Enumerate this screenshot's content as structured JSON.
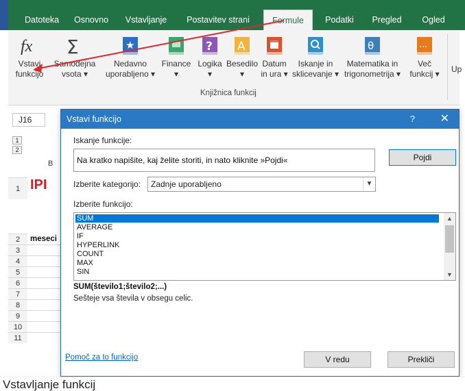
{
  "ribbon_tabs": [
    {
      "label": "Datoteka"
    },
    {
      "label": "Osnovno"
    },
    {
      "label": "Vstavljanje"
    },
    {
      "label": "Postavitev strani"
    },
    {
      "label": "Formule",
      "active": true
    },
    {
      "label": "Podatki"
    },
    {
      "label": "Pregled"
    },
    {
      "label": "Ogled"
    }
  ],
  "ribbon": {
    "buttons": [
      {
        "line1": "Vstavi",
        "line2": "funkcijo",
        "icon": "fx-icon"
      },
      {
        "line1": "Samodejna",
        "line2": "vsota ▾",
        "icon": "sigma-icon"
      },
      {
        "line1": "Nedavno",
        "line2": "uporabljeno ▾",
        "icon": "star-book-icon"
      },
      {
        "line1": "Finance",
        "line2": "▾",
        "icon": "finance-book-icon"
      },
      {
        "line1": "Logika",
        "line2": "▾",
        "icon": "question-book-icon"
      },
      {
        "line1": "Besedilo",
        "line2": "▾",
        "icon": "text-book-icon"
      },
      {
        "line1": "Datum",
        "line2": "in ura ▾",
        "icon": "calendar-book-icon"
      },
      {
        "line1": "Iskanje in",
        "line2": "sklicevanje ▾",
        "icon": "lookup-book-icon"
      },
      {
        "line1": "Matematika in",
        "line2": "trigonometrija ▾",
        "icon": "theta-book-icon"
      },
      {
        "line1": "Več",
        "line2": "funkcij ▾",
        "icon": "more-book-icon"
      }
    ],
    "group_label": "Knjižnica funkcij",
    "overflow_label": "Up"
  },
  "sheet": {
    "namebox": "J16",
    "rows": [
      "1",
      "2",
      "3",
      "4",
      "5",
      "6",
      "7",
      "8",
      "9",
      "10",
      "11"
    ],
    "header_col": "B",
    "cell_ipi": "IPI",
    "cell_meseci": "meseci"
  },
  "dialog": {
    "title": "Vstavi funkcijo",
    "help": "?",
    "search_label": "Iskanje funkcije:",
    "search_value": "Na kratko napišite, kaj želite storiti, in nato kliknite »Pojdi«",
    "go_button": "Pojdi",
    "category_label": "Izberite kategorijo:",
    "category_value": "Zadnje uporabljeno",
    "function_label": "Izberite funkcijo:",
    "functions": [
      "SUM",
      "AVERAGE",
      "IF",
      "HYPERLINK",
      "COUNT",
      "MAX",
      "SIN"
    ],
    "signature": "SUM(število1;število2;...)",
    "description": "Sešteje vsa števila v obsegu celic.",
    "help_link": "Pomoč za to funkcijo",
    "ok_button": "V redu",
    "cancel_button": "Prekliči"
  },
  "caption": "Vstavljanje funkcij",
  "colors": {
    "excel_green": "#217346",
    "dialog_blue": "#2b79c2",
    "selection_blue": "#0078d7",
    "arrow_red": "#e0262b"
  }
}
